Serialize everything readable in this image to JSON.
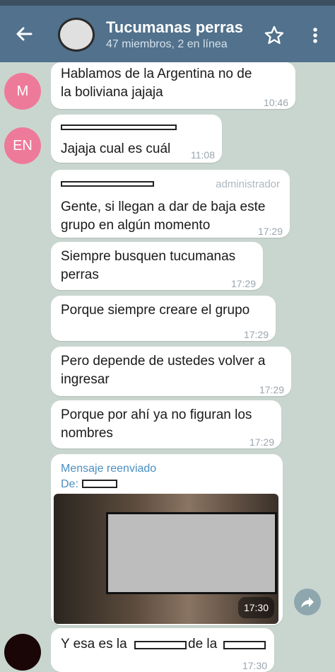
{
  "header": {
    "title": "Tucumanas perras",
    "subtitle": "47 miembros, 2 en línea"
  },
  "avatars": {
    "m": "M",
    "en": "EN"
  },
  "messages": [
    {
      "text_lines": [
        "Hablamos de la Argentina no de",
        "la boliviana jajaja"
      ],
      "time": "10:46"
    },
    {
      "text": "Jajaja cual es cuál",
      "time": "11:08"
    },
    {
      "admin_tag": "administrador",
      "text_lines": [
        "Gente, si llegan a dar de baja este",
        "grupo en algún momento"
      ],
      "time": "17:29"
    },
    {
      "text_lines": [
        "Siempre busquen tucumanas",
        "perras"
      ],
      "time": "17:29"
    },
    {
      "text": "Porque siempre creare el grupo",
      "time": "17:29"
    },
    {
      "text_lines": [
        "Pero depende de ustedes volver a",
        "ingresar"
      ],
      "time": "17:29"
    },
    {
      "text_lines": [
        "Porque por ahí ya no figuran los",
        "nombres"
      ],
      "time": "17:29"
    },
    {
      "forwarded_label": "Mensaje reenviado",
      "from_label": "De:",
      "time": "17:30"
    },
    {
      "text_parts": [
        "Y esa es la",
        "de la"
      ],
      "time": "17:30"
    }
  ],
  "colors": {
    "appbar": "#51718c",
    "chat_background": "#c9d6cf",
    "avatar_pink": "#ee7a9a",
    "sender_green": "#4db048",
    "forward_blue": "#4a8ec1"
  }
}
